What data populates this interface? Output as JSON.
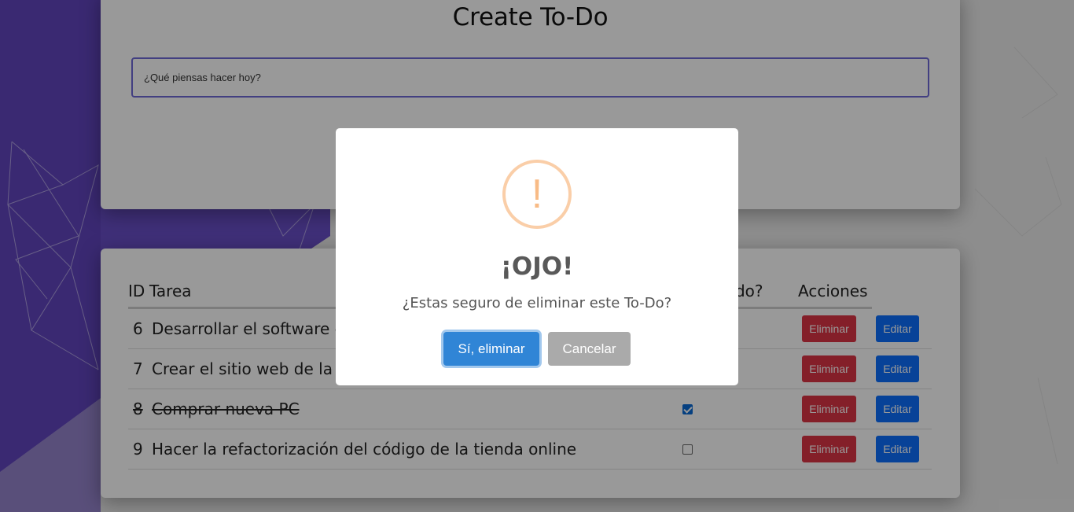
{
  "app": {
    "title": "Create To-Do",
    "input_placeholder": "¿Qué piensas hacer hoy?"
  },
  "table": {
    "headers": {
      "id": "ID",
      "task": "Tarea",
      "completed": "¿Completado?",
      "actions": "Acciones"
    },
    "rows": [
      {
        "id": "6",
        "task": "Desarrollar el software de",
        "completed": false,
        "done": false,
        "delete_label": "Eliminar",
        "edit_label": "Editar"
      },
      {
        "id": "7",
        "task": "Crear el sitio web de la ba",
        "completed": false,
        "done": false,
        "delete_label": "Eliminar",
        "edit_label": "Editar"
      },
      {
        "id": "8",
        "task": "Comprar nueva PC",
        "completed": true,
        "done": true,
        "delete_label": "Eliminar",
        "edit_label": "Editar"
      },
      {
        "id": "9",
        "task": "Hacer la refactorización del código de la tienda online",
        "completed": false,
        "done": false,
        "delete_label": "Eliminar",
        "edit_label": "Editar"
      }
    ]
  },
  "dialog": {
    "icon": "warning-icon",
    "icon_glyph": "!",
    "title": "¡OJO!",
    "text": "¿Estas seguro de eliminar este To-Do?",
    "confirm_label": "Sí, eliminar",
    "cancel_label": "Cancelar"
  },
  "colors": {
    "background_purple": "#6a4fc9",
    "danger": "#dc3545",
    "primary": "#0d6efd",
    "confirm": "#3085d6",
    "cancel": "#aaaaaa",
    "warning": "#f8bb86"
  }
}
